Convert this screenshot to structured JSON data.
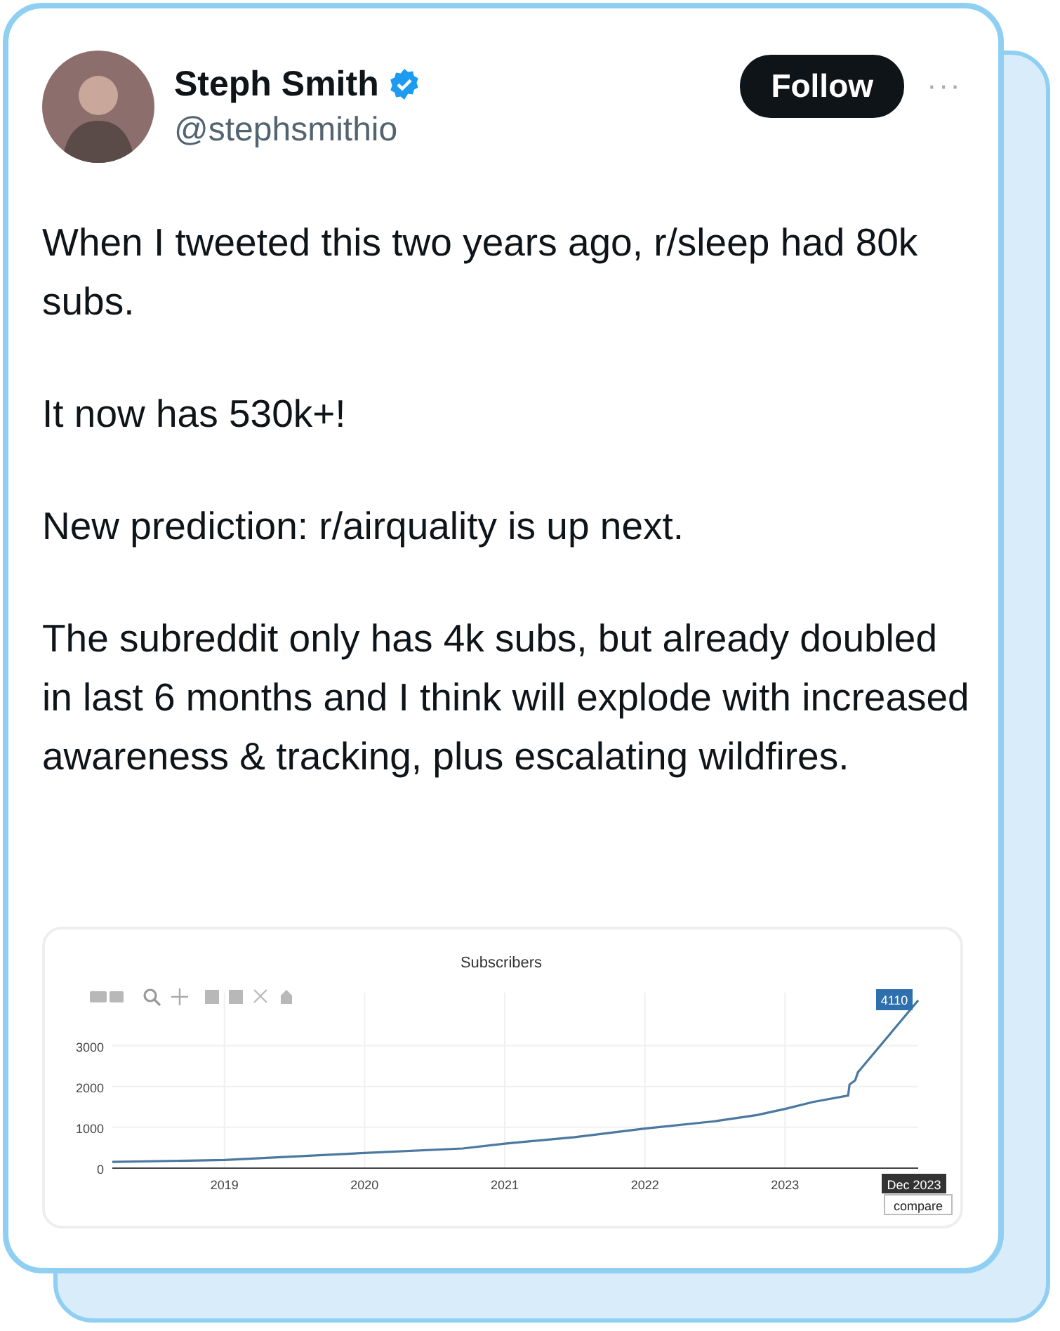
{
  "author": {
    "name": "Steph Smith",
    "verified": true,
    "handle": "@stephsmithio"
  },
  "follow_button": "Follow",
  "more_button": "···",
  "paragraphs": [
    "When I tweeted this two years ago, r/sleep had 80k subs.",
    "It now has 530k+!",
    "New prediction: r/airquality is up next.",
    "The subreddit only has 4k subs, but already doubled in last 6 months and I think will explode with increased awareness & tracking, plus escalating wildfires."
  ],
  "chart": {
    "chart_data": {
      "type": "line",
      "title": "Subscribers",
      "x": [
        2018.2,
        2019,
        2020,
        2020.7,
        2021,
        2021.5,
        2022,
        2022.5,
        2022.8,
        2023,
        2023.2,
        2023.45,
        2023.46,
        2023.5,
        2023.52,
        2023.95
      ],
      "grid": true,
      "series": [
        {
          "color": "#4a78a0",
          "values": [
            150,
            200,
            370,
            480,
            600,
            760,
            970,
            1150,
            1300,
            1450,
            1620,
            1780,
            2050,
            2150,
            2350,
            4110
          ]
        }
      ],
      "xlim": [
        2018.2,
        2023.95
      ],
      "ylim": [
        0,
        4300
      ],
      "xticks": [
        2019,
        2020,
        2021,
        2022,
        2023
      ],
      "yticks": [
        0,
        1000,
        2000,
        3000
      ],
      "annotations": [
        {
          "text": "4110",
          "x": 2023.95,
          "y": 4110
        },
        "Dec 2023",
        "compare"
      ]
    }
  }
}
